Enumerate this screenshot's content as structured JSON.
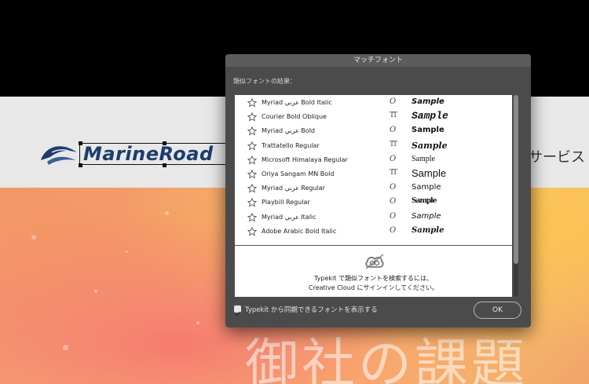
{
  "website": {
    "logo_text": "MarineRoad",
    "nav_partial": "サービス",
    "hero_title_partial": "御社の課題",
    "colors": {
      "logo_blue": "#1d3c6e",
      "header_bg": "#e8e8e8"
    }
  },
  "dialog": {
    "title": "マッチフォント",
    "results_label": "類似フォントの結果：",
    "fonts": [
      {
        "name": "Myriad عربي Bold Italic",
        "type_icon": "opentype-icon",
        "type_glyph": "O",
        "sample": "Sample",
        "sample_style": "bold-italic"
      },
      {
        "name": "Courier Bold Oblique",
        "type_icon": "truetype-icon",
        "type_glyph": "TT",
        "sample": "Sample",
        "sample_style": "courier-bold-oblique"
      },
      {
        "name": "Myriad عربي Bold",
        "type_icon": "opentype-icon",
        "type_glyph": "O",
        "sample": "Sample",
        "sample_style": "bold"
      },
      {
        "name": "Trattatello Regular",
        "type_icon": "truetype-icon",
        "type_glyph": "TT",
        "sample": "Sample",
        "sample_style": "script"
      },
      {
        "name": "Microsoft Himalaya Regular",
        "type_icon": "opentype-icon",
        "type_glyph": "O",
        "sample": "Sample",
        "sample_style": "serif-small"
      },
      {
        "name": "Oriya Sangam MN Bold",
        "type_icon": "truetype-icon",
        "type_glyph": "TT",
        "sample": "Sample",
        "sample_style": "sans-large"
      },
      {
        "name": "Myriad عربي Regular",
        "type_icon": "opentype-icon",
        "type_glyph": "O",
        "sample": "Sample",
        "sample_style": "regular"
      },
      {
        "name": "Playbill Regular",
        "type_icon": "opentype-icon",
        "type_glyph": "O",
        "sample": "Sample",
        "sample_style": "condensed"
      },
      {
        "name": "Myriad عربي Italic",
        "type_icon": "opentype-icon",
        "type_glyph": "O",
        "sample": "Sample",
        "sample_style": "italic"
      },
      {
        "name": "Adobe Arabic Bold Italic",
        "type_icon": "opentype-icon",
        "type_glyph": "O",
        "sample": "Sample",
        "sample_style": "serif-bold-italic"
      }
    ],
    "typekit_line1": "Typekit で類似フォントを検索するには、",
    "typekit_line2": "Creative Cloud にサインインしてください。",
    "typekit_checkbox_label": "Typekit から同期できるフォントを表示する",
    "typekit_checkbox_checked": true,
    "ok_label": "OK",
    "colors": {
      "dialog_bg": "#4b4b4b",
      "title_bg": "#5c5c5c",
      "list_bg": "#ffffff"
    }
  }
}
